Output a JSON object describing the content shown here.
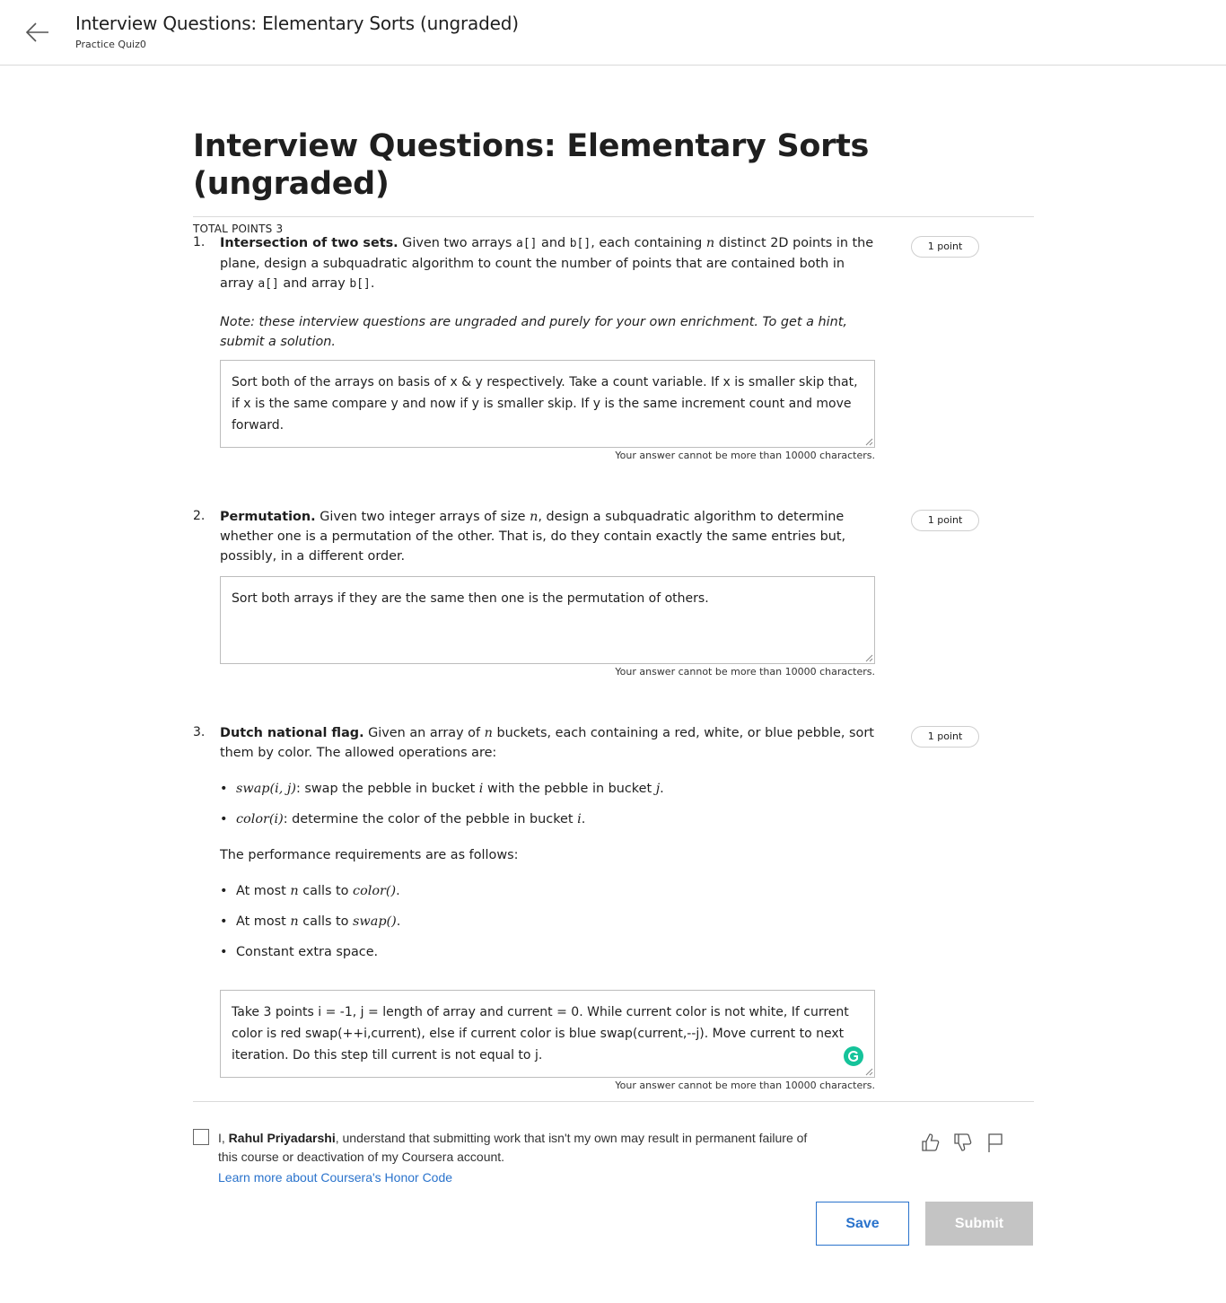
{
  "header": {
    "title": "Interview Questions: Elementary Sorts (ungraded)",
    "subtitle": "Practice Quiz0",
    "back_icon": "arrow-left-icon"
  },
  "main": {
    "title": "Interview Questions: Elementary Sorts (ungraded)",
    "total_points": "TOTAL POINTS 3"
  },
  "questions": [
    {
      "number": "1.",
      "points": "1 point",
      "title": "Intersection of two sets.",
      "text_a": " Given two arrays ",
      "code_a": "a[]",
      "text_b": " and ",
      "code_b": "b[]",
      "text_c": ", each containing ",
      "var_n": "n",
      "text_d": " distinct 2D points in the plane, design a subquadratic algorithm to count the number of points that are contained both in array ",
      "code_c": "a[]",
      "text_e": " and array ",
      "code_d": "b[]",
      "text_f": ".",
      "note": "Note: these interview questions are ungraded and purely for your own enrichment. To get a hint, submit a solution.",
      "answer": "Sort both of the arrays on basis of x & y respectively. Take a count variable.  If x is smaller skip that, if x is the same compare y and now if y is smaller skip. If y is the same increment count and move forward.",
      "limit": "Your answer cannot be more than 10000 characters."
    },
    {
      "number": "2.",
      "points": "1 point",
      "title": "Permutation.",
      "text_a": " Given two integer arrays of size ",
      "var_n": "n",
      "text_b": ", design a subquadratic algorithm to determine whether one is a permutation of the other. That is, do they contain exactly the same entries but, possibly, in a different order.",
      "answer": "Sort both arrays if they are the same then one is the permutation of others.",
      "limit": "Your answer cannot be more than 10000 characters."
    },
    {
      "number": "3.",
      "points": "1 point",
      "title": "Dutch national flag.",
      "text_a": " Given an array of ",
      "var_n": "n",
      "text_b": " buckets, each containing a red, white, or blue pebble, sort them by color. The allowed operations are:",
      "op1_math": "swap(i, j)",
      "op1_text_a": ": swap the pebble in bucket ",
      "op1_var_i": "i",
      "op1_text_b": " with the pebble in bucket ",
      "op1_var_j": "j",
      "op1_text_c": ".",
      "op2_math": "color(i)",
      "op2_text_a": ": determine the color of the pebble in bucket ",
      "op2_var_i": "i",
      "op2_text_b": ".",
      "perf_intro": "The performance requirements are as follows:",
      "req1_a": "At most ",
      "req1_n": "n",
      "req1_b": " calls to ",
      "req1_math": "color()",
      "req1_c": ".",
      "req2_a": "At most ",
      "req2_n": "n",
      "req2_b": " calls to ",
      "req2_math": "swap()",
      "req2_c": ".",
      "req3": "Constant extra space.",
      "answer": "Take 3 points i = -1, j = length of array and current = 0. While current color is not white, If current color is red swap(++i,current), else if current color is blue swap(current,--j). Move current to next iteration. Do this step till current is not equal to j.",
      "limit": "Your answer cannot be more than 10000 characters."
    }
  ],
  "honor": {
    "prefix": "I, ",
    "name": "Rahul Priyadarshi",
    "suffix": ", understand that submitting work that isn't my own may result in permanent failure of this course or deactivation of my Coursera account.",
    "link": "Learn more about Coursera's Honor Code",
    "icons": [
      "thumbs-up-icon",
      "thumbs-down-icon",
      "flag-icon"
    ]
  },
  "actions": {
    "save": "Save",
    "submit": "Submit"
  },
  "colors": {
    "accent": "#2a73cc",
    "submit_disabled": "#c4c4c4",
    "grammarly": "#15c39a"
  }
}
